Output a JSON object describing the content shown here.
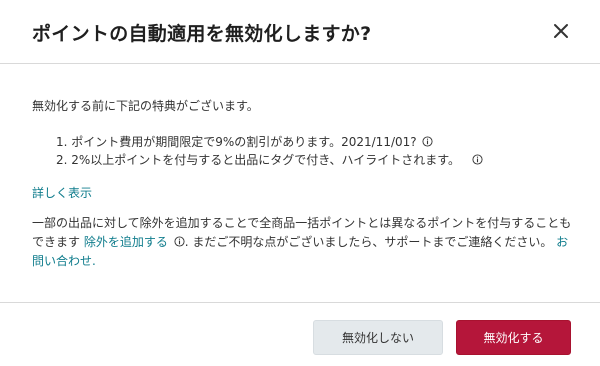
{
  "dialog": {
    "title": "ポイントの自動適用を無効化しますか?",
    "close_icon": "close-icon"
  },
  "body": {
    "intro": "無効化する前に下記の特典がございます。",
    "benefits": [
      "1. ポイント費用が期間限定で9%の割引があります。2021/11/01?",
      "2. 2%以上ポイントを付与すると出品にタグで付き、ハイライトされます。"
    ],
    "info_icon": "info-icon",
    "show_more": "詳しく表示",
    "notice": {
      "part1": "一部の出品に対して除外を追加することで全商品一括ポイントとは異なるポイントを付与することもできます",
      "link_add_exclusion": "除外を追加する",
      "part2": ". まだご不明な点がございましたら、サポートまでご連絡ください。",
      "link_contact": "お問い合わせ."
    }
  },
  "footer": {
    "cancel_label": "無効化しない",
    "confirm_label": "無効化する"
  },
  "colors": {
    "primary": "#b5163a",
    "link": "#0f7c8c",
    "secondary_bg": "#e4e9ec"
  }
}
